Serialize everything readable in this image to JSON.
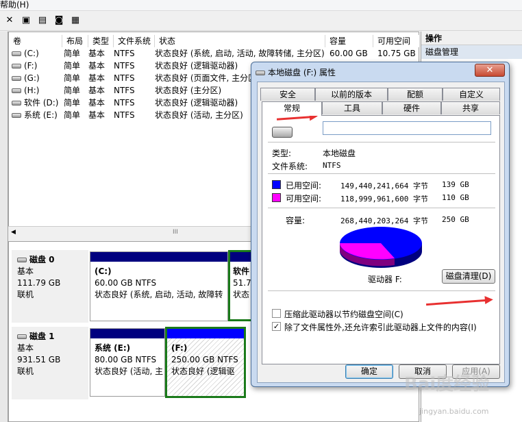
{
  "menubar": {
    "help": "帮助(H)"
  },
  "toolbar": {
    "icons": [
      "close-icon",
      "properties-icon",
      "open-icon",
      "help-icon",
      "disk-icon"
    ],
    "glyphs": [
      "✕",
      "▣",
      "▤",
      "◙",
      "▦"
    ]
  },
  "volume_table": {
    "headers": [
      "卷",
      "布局",
      "类型",
      "文件系统",
      "状态",
      "容量",
      "可用空间"
    ],
    "rows": [
      {
        "vol": "(C:)",
        "layout": "简单",
        "type": "基本",
        "fs": "NTFS",
        "status": "状态良好 (系统, 启动, 活动, 故障转储, 主分区)",
        "capacity": "60.00 GB",
        "free": "10.75 GB"
      },
      {
        "vol": "(F:)",
        "layout": "简单",
        "type": "基本",
        "fs": "NTFS",
        "status": "状态良好 (逻辑驱动器)",
        "capacity": "",
        "free": ""
      },
      {
        "vol": "(G:)",
        "layout": "简单",
        "type": "基本",
        "fs": "NTFS",
        "status": "状态良好 (页面文件, 主分区)",
        "capacity": "",
        "free": ""
      },
      {
        "vol": "(H:)",
        "layout": "简单",
        "type": "基本",
        "fs": "NTFS",
        "status": "状态良好 (主分区)",
        "capacity": "",
        "free": ""
      },
      {
        "vol": "软件 (D:)",
        "layout": "简单",
        "type": "基本",
        "fs": "NTFS",
        "status": "状态良好 (逻辑驱动器)",
        "capacity": "",
        "free": ""
      },
      {
        "vol": "系统 (E:)",
        "layout": "简单",
        "type": "基本",
        "fs": "NTFS",
        "status": "状态良好 (活动, 主分区)",
        "capacity": "",
        "free": ""
      }
    ]
  },
  "hscroll": {
    "grip": "III"
  },
  "disks": [
    {
      "name": "磁盘 0",
      "type": "基本",
      "size": "111.79 GB",
      "state": "联机",
      "parts": [
        {
          "name": "(C:)",
          "size": "60.00 GB NTFS",
          "status": "状态良好 (系统, 启动, 活动, 故障转"
        },
        {
          "name": "软件",
          "size": "51.7",
          "status": "状态"
        }
      ]
    },
    {
      "name": "磁盘 1",
      "type": "基本",
      "size": "931.51 GB",
      "state": "联机",
      "parts": [
        {
          "name": "系统  (E:)",
          "size": "80.00 GB NTFS",
          "status": "状态良好 (活动, 主"
        },
        {
          "name": "(F:)",
          "size": "250.00 GB NTFS",
          "status": "状态良好 (逻辑驱"
        }
      ]
    }
  ],
  "actions": {
    "title": "操作",
    "item": "磁盘管理"
  },
  "dialog": {
    "title": "本地磁盘 (F:) 属性",
    "close": "✕",
    "tabs_top": [
      "安全",
      "以前的版本",
      "配额",
      "自定义"
    ],
    "tabs_bottom": [
      "常规",
      "工具",
      "硬件",
      "共享"
    ],
    "name_value": "",
    "type_label": "类型:",
    "type_value": "本地磁盘",
    "fs_label": "文件系统:",
    "fs_value": "NTFS",
    "used_label": "已用空间:",
    "used_bytes": "149,440,241,664 字节",
    "used_gb": "139 GB",
    "used_color": "#0000ff",
    "free_label": "可用空间:",
    "free_bytes": "118,999,961,600 字节",
    "free_gb": "110 GB",
    "free_color": "#ff00ff",
    "cap_label": "容量:",
    "cap_bytes": "268,440,203,264 字节",
    "cap_gb": "250 GB",
    "drive_label": "驱动器 F:",
    "cleanup": "磁盘清理(D)",
    "compress": "压缩此驱动器以节约磁盘空间(C)",
    "index": "除了文件属性外,还允许索引此驱动器上文件的内容(I)",
    "ok": "确定",
    "cancel": "取消",
    "apply": "应用(A)"
  },
  "watermark": {
    "text": "Bai度经验",
    "url": "jingyan.baidu.com"
  }
}
